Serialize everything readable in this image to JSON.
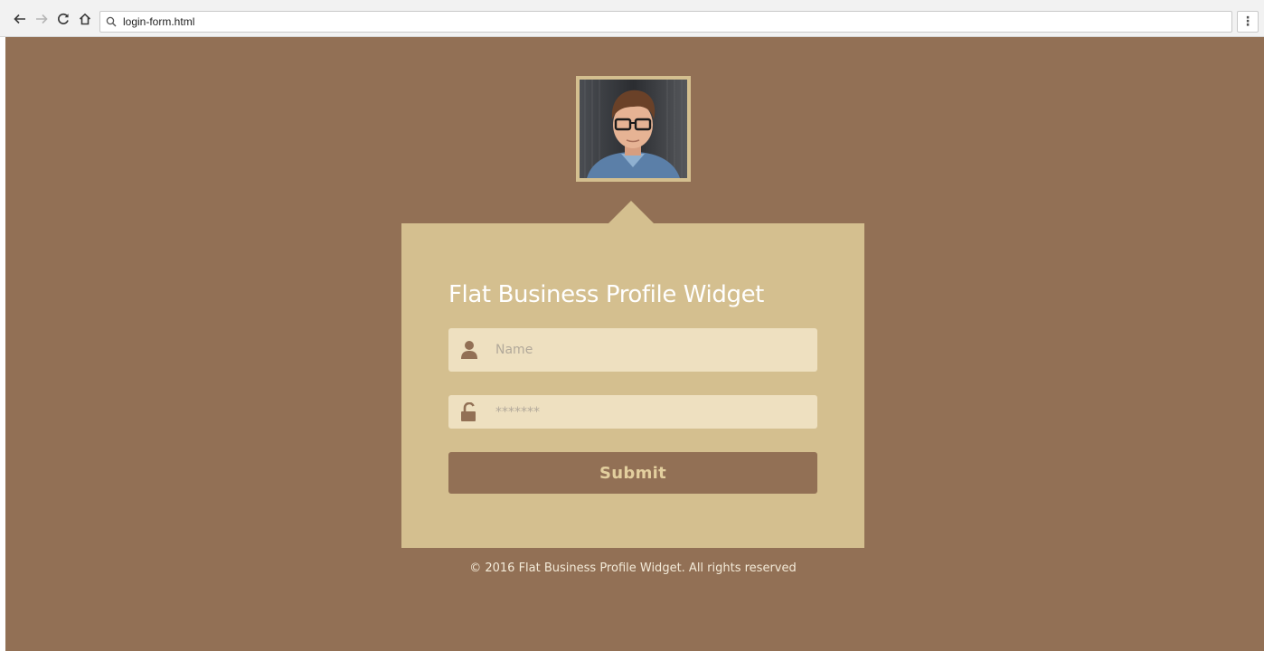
{
  "browser": {
    "url": "login-form.html",
    "menu_label": "⋮"
  },
  "colors": {
    "page_background": "#927055",
    "card_background": "#d4bf8f",
    "input_background": "#eee0c0",
    "button_background": "#927055",
    "button_text": "#e3cf9e",
    "title_text": "#ffffff"
  },
  "profile": {
    "avatar_icon": "profile-photo"
  },
  "form": {
    "title": "Flat Business Profile Widget",
    "name_field": {
      "placeholder": "Name",
      "icon": "user-icon"
    },
    "password_field": {
      "placeholder": "*******",
      "icon": "unlock-icon"
    },
    "submit_label": "Submit"
  },
  "footer": {
    "text": "© 2016 Flat Business Profile Widget. All rights reserved"
  }
}
